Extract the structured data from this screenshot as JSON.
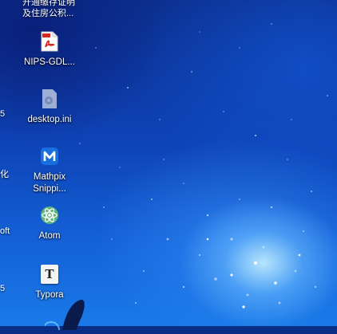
{
  "desktop": {
    "top_label": "及住房公积...",
    "icons": [
      {
        "label": "NIPS-GDL...",
        "icon": "pdf-icon"
      },
      {
        "label": "desktop.ini",
        "icon": "config-file-icon"
      },
      {
        "label": "Mathpix\nSnippi...",
        "icon": "mathpix-icon"
      },
      {
        "label": "Atom",
        "icon": "atom-icon"
      },
      {
        "label": "Typora",
        "icon": "typora-icon"
      }
    ],
    "left_column_fragments": [
      "5",
      "化",
      "oft",
      "5"
    ]
  },
  "colors": {
    "pdf_red": "#d9261c",
    "mathpix_blue": "#1a6fe0",
    "atom_green": "#5fb57d"
  }
}
